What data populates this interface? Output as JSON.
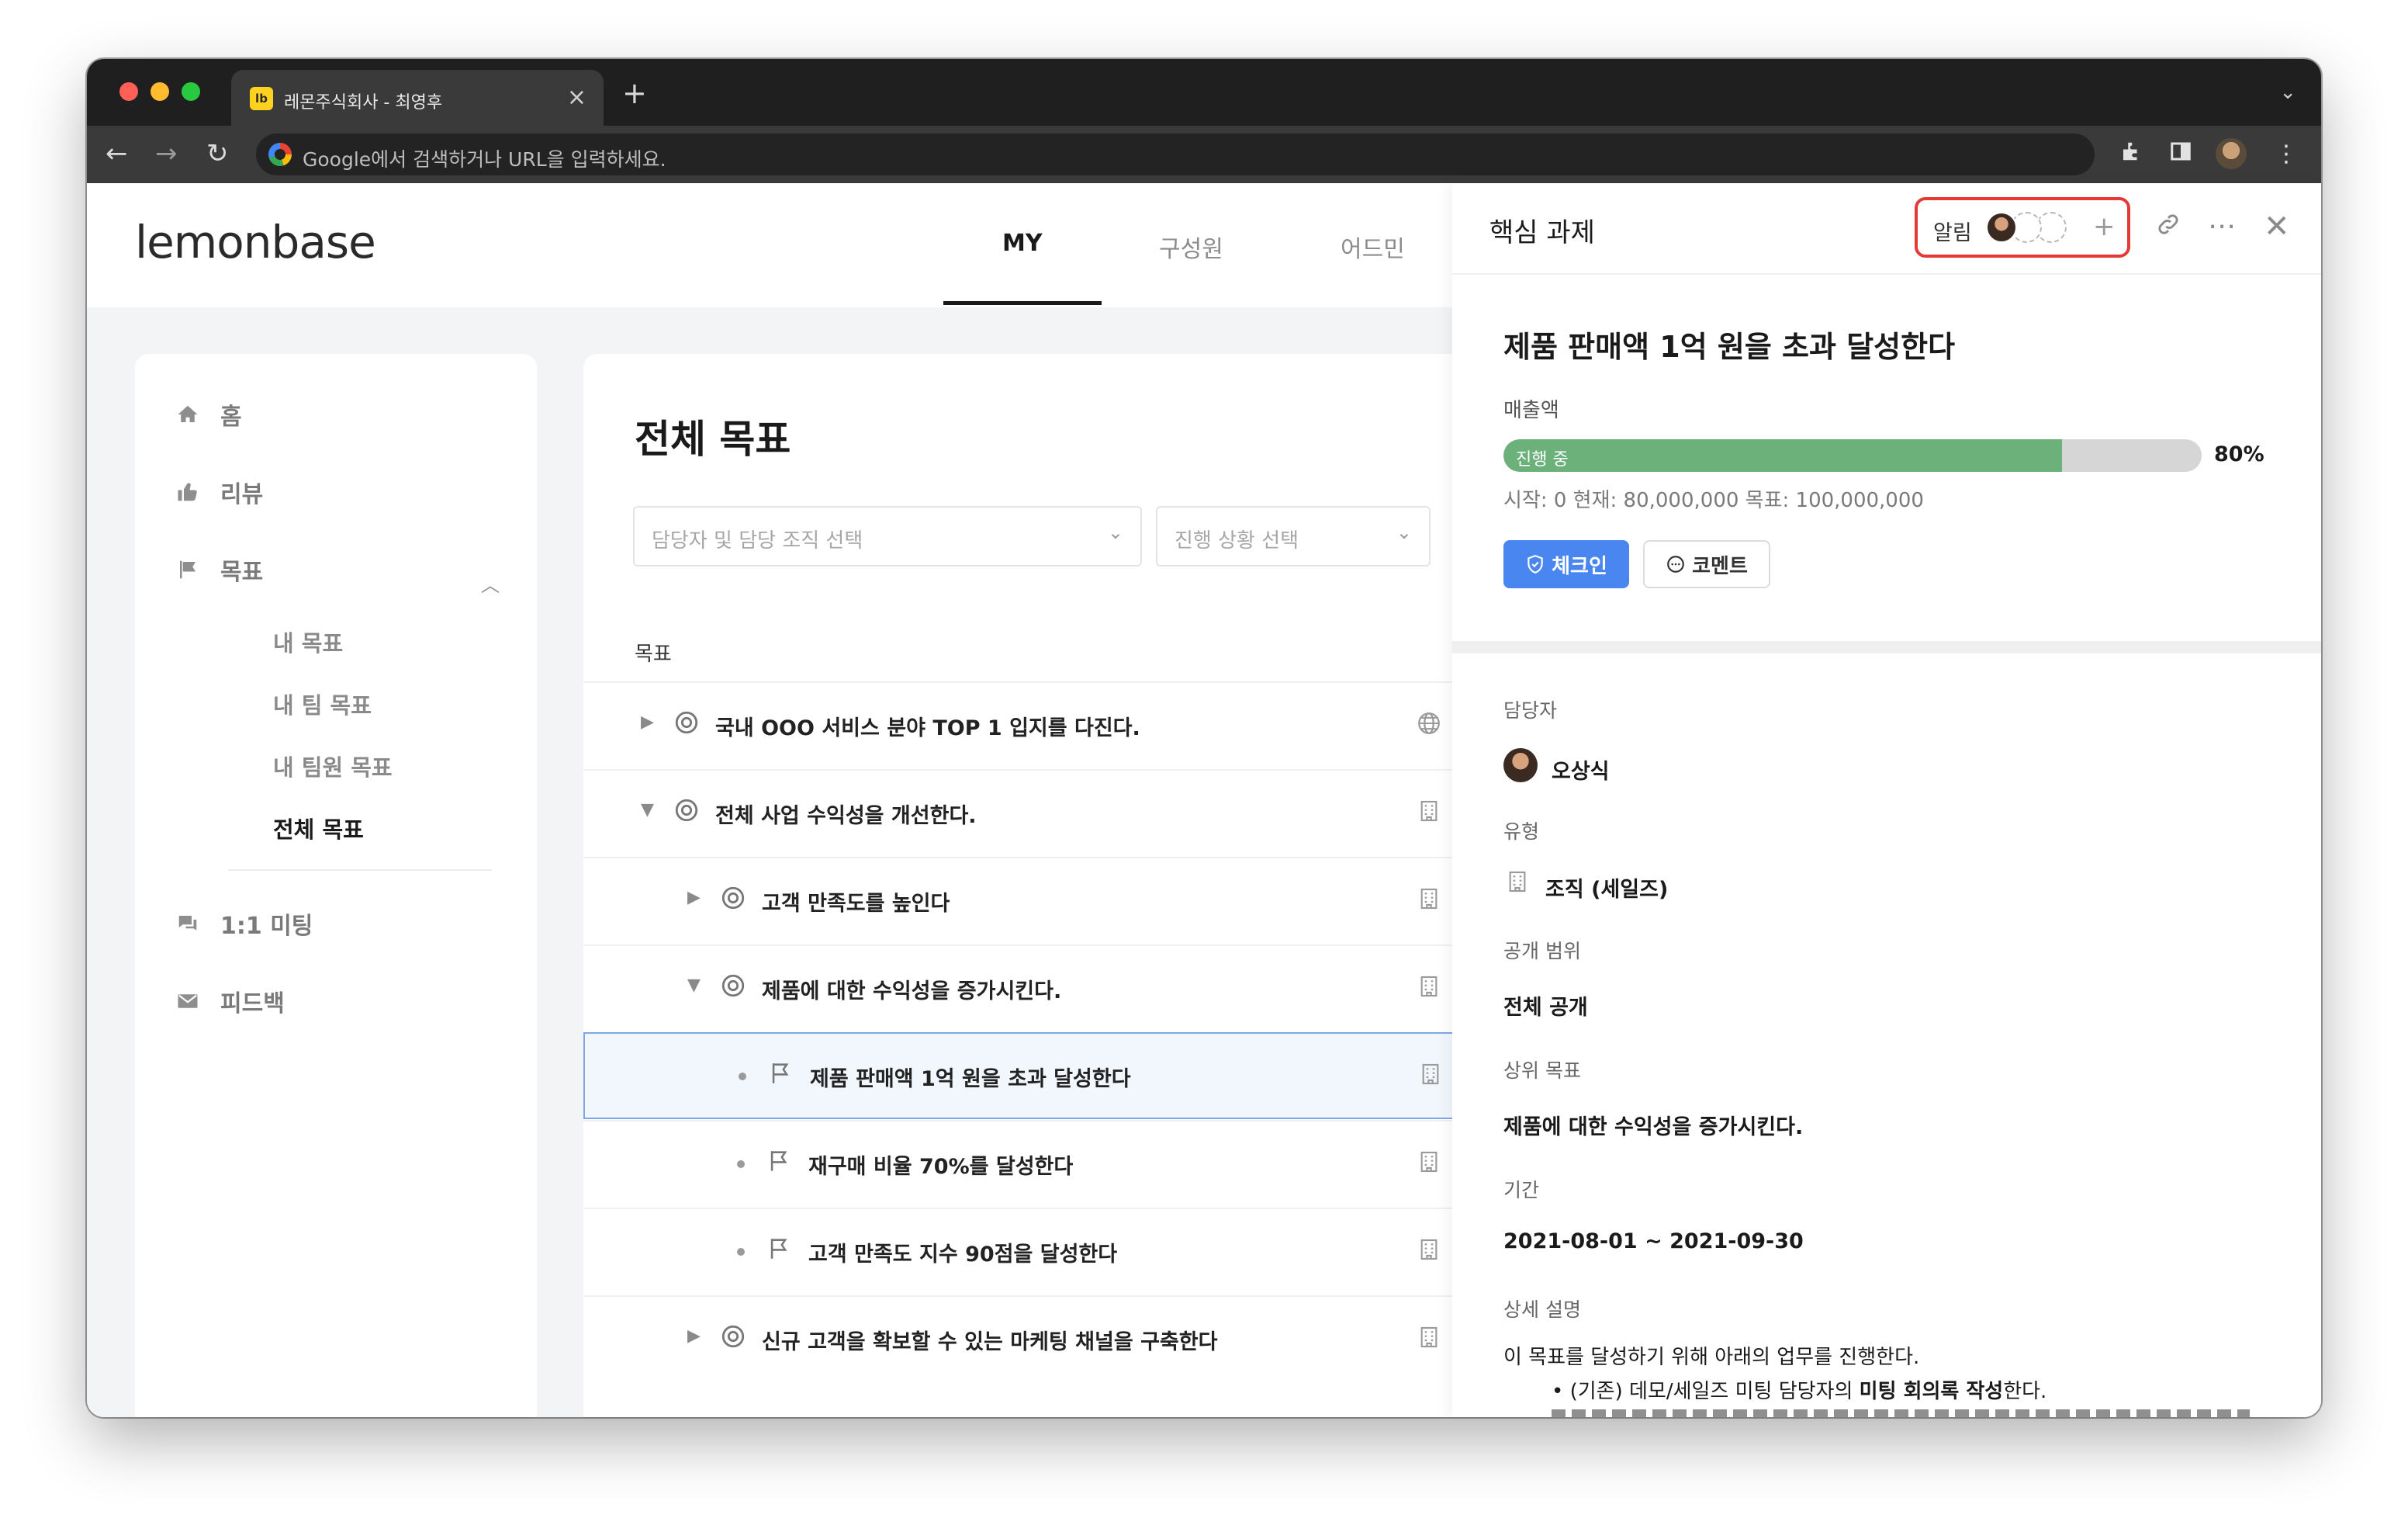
{
  "browser": {
    "tab_title": "레몬주식회사 - 최영후",
    "tab_favicon": "lb",
    "omnibox_placeholder": "Google에서 검색하거나 URL을 입력하세요."
  },
  "header": {
    "logo": "lemonbase",
    "nav": {
      "my": "MY",
      "members": "구성원",
      "admin": "어드민"
    },
    "active_nav": "MY"
  },
  "sidebar": {
    "home": "홈",
    "review": "리뷰",
    "goals": "목표",
    "goal_sub": [
      "내 목표",
      "내 팀 목표",
      "내 팀원 목표",
      "전체 목표"
    ],
    "active_sub": "전체 목표",
    "meeting": "1:1 미팅",
    "feedback": "피드백"
  },
  "main": {
    "title": "전체 목표",
    "owner_select_placeholder": "담당자 및 담당 조직 선택",
    "status_select_placeholder": "진행 상황 선택",
    "column_header": "목표",
    "rows": [
      {
        "text": "국내 OOO 서비스 분야 TOP 1 입지를 다진다.",
        "icon": "target-icon",
        "end_icon": "globe-icon",
        "level": 0,
        "caret": "collapsed"
      },
      {
        "text": "전체 사업 수익성을 개선한다.",
        "icon": "target-icon",
        "end_icon": "building-icon",
        "level": 0,
        "caret": "expanded"
      },
      {
        "text": "고객 만족도를 높인다",
        "icon": "target-icon",
        "end_icon": "building-icon",
        "level": 1,
        "caret": "collapsed"
      },
      {
        "text": "제품에 대한 수익성을 증가시킨다.",
        "icon": "target-icon",
        "end_icon": "building-icon",
        "level": 1,
        "caret": "expanded"
      },
      {
        "text": "제품 판매액 1억 원을 초과 달성한다",
        "icon": "flag-icon",
        "end_icon": "building-icon",
        "level": 2,
        "caret": "bullet",
        "selected": true
      },
      {
        "text": "재구매 비율 70%를 달성한다",
        "icon": "flag-icon",
        "end_icon": "building-icon",
        "level": 2,
        "caret": "bullet"
      },
      {
        "text": "고객 만족도 지수 90점을 달성한다",
        "icon": "flag-icon",
        "end_icon": "building-icon",
        "level": 2,
        "caret": "bullet"
      },
      {
        "text": "신규 고객을 확보할 수 있는 마케팅 채널을 구축한다",
        "icon": "target-icon",
        "end_icon": "building-icon",
        "level": 1,
        "caret": "collapsed"
      }
    ]
  },
  "panel": {
    "title": "핵심 과제",
    "notify_label": "알림",
    "goal_title": "제품 판매액 1억 원을 초과 달성한다",
    "metric_label": "매출액",
    "progress_status": "진행 중",
    "progress_percent": "80%",
    "progress_fraction": 0.8,
    "progress_stats": "시작: 0  현재: 80,000,000  목표: 100,000,000",
    "checkin_label": "체크인",
    "comment_label": "코멘트",
    "owner_label": "담당자",
    "owner_name": "오상식",
    "type_label": "유형",
    "type_value": "조직 (세일즈)",
    "visibility_label": "공개 범위",
    "visibility_value": "전체 공개",
    "parent_label": "상위 목표",
    "parent_value": "제품에 대한 수익성을 증가시킨다.",
    "period_label": "기간",
    "period_value": "2021-08-01 ~ 2021-09-30",
    "description_label": "상세 설명",
    "description_intro": "이 목표를 달성하기 위해 아래의 업무를 진행한다.",
    "description_bullet_prefix": "• (기존) 데모/세일즈 미팅 담당자의 ",
    "description_bullet_bold": "미팅 회의록 작성",
    "description_bullet_suffix": "한다."
  },
  "colors": {
    "accent_blue": "#4a86f0",
    "progress_green": "#6cb07a",
    "highlight_red": "#e53935",
    "selected_row_bg": "#f2f7fd"
  }
}
